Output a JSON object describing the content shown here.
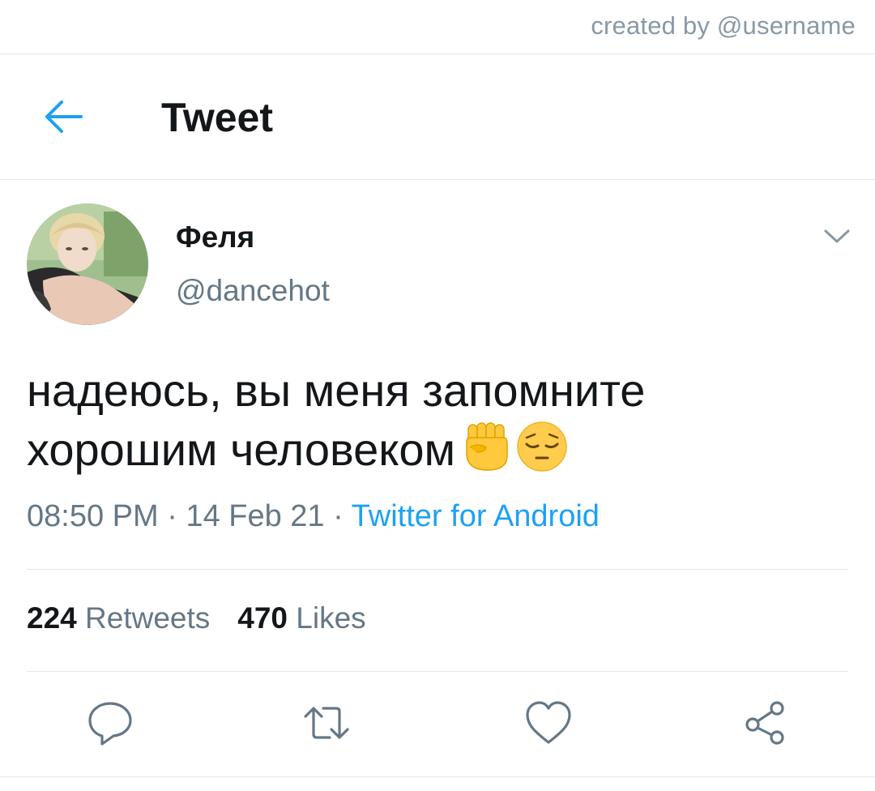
{
  "credit": "created by @username",
  "header": {
    "title": "Tweet"
  },
  "tweet": {
    "display_name": "Феля",
    "handle": "@dancehot",
    "text_line1": "надеюсь, вы меня запомните",
    "text_line2": "хорошим человеком",
    "emojis": [
      "raised-fist-emoji",
      "pensive-face-emoji"
    ],
    "time": "08:50 PM",
    "separator": " · ",
    "date": "14 Feb 21",
    "source": "Twitter for Android"
  },
  "stats": {
    "retweets_count": "224",
    "retweets_label": "Retweets",
    "likes_count": "470",
    "likes_label": "Likes"
  },
  "colors": {
    "accent": "#1da1f2",
    "secondary_text": "#657786",
    "divider": "#e1e8ed",
    "icon_gray": "#657786"
  }
}
